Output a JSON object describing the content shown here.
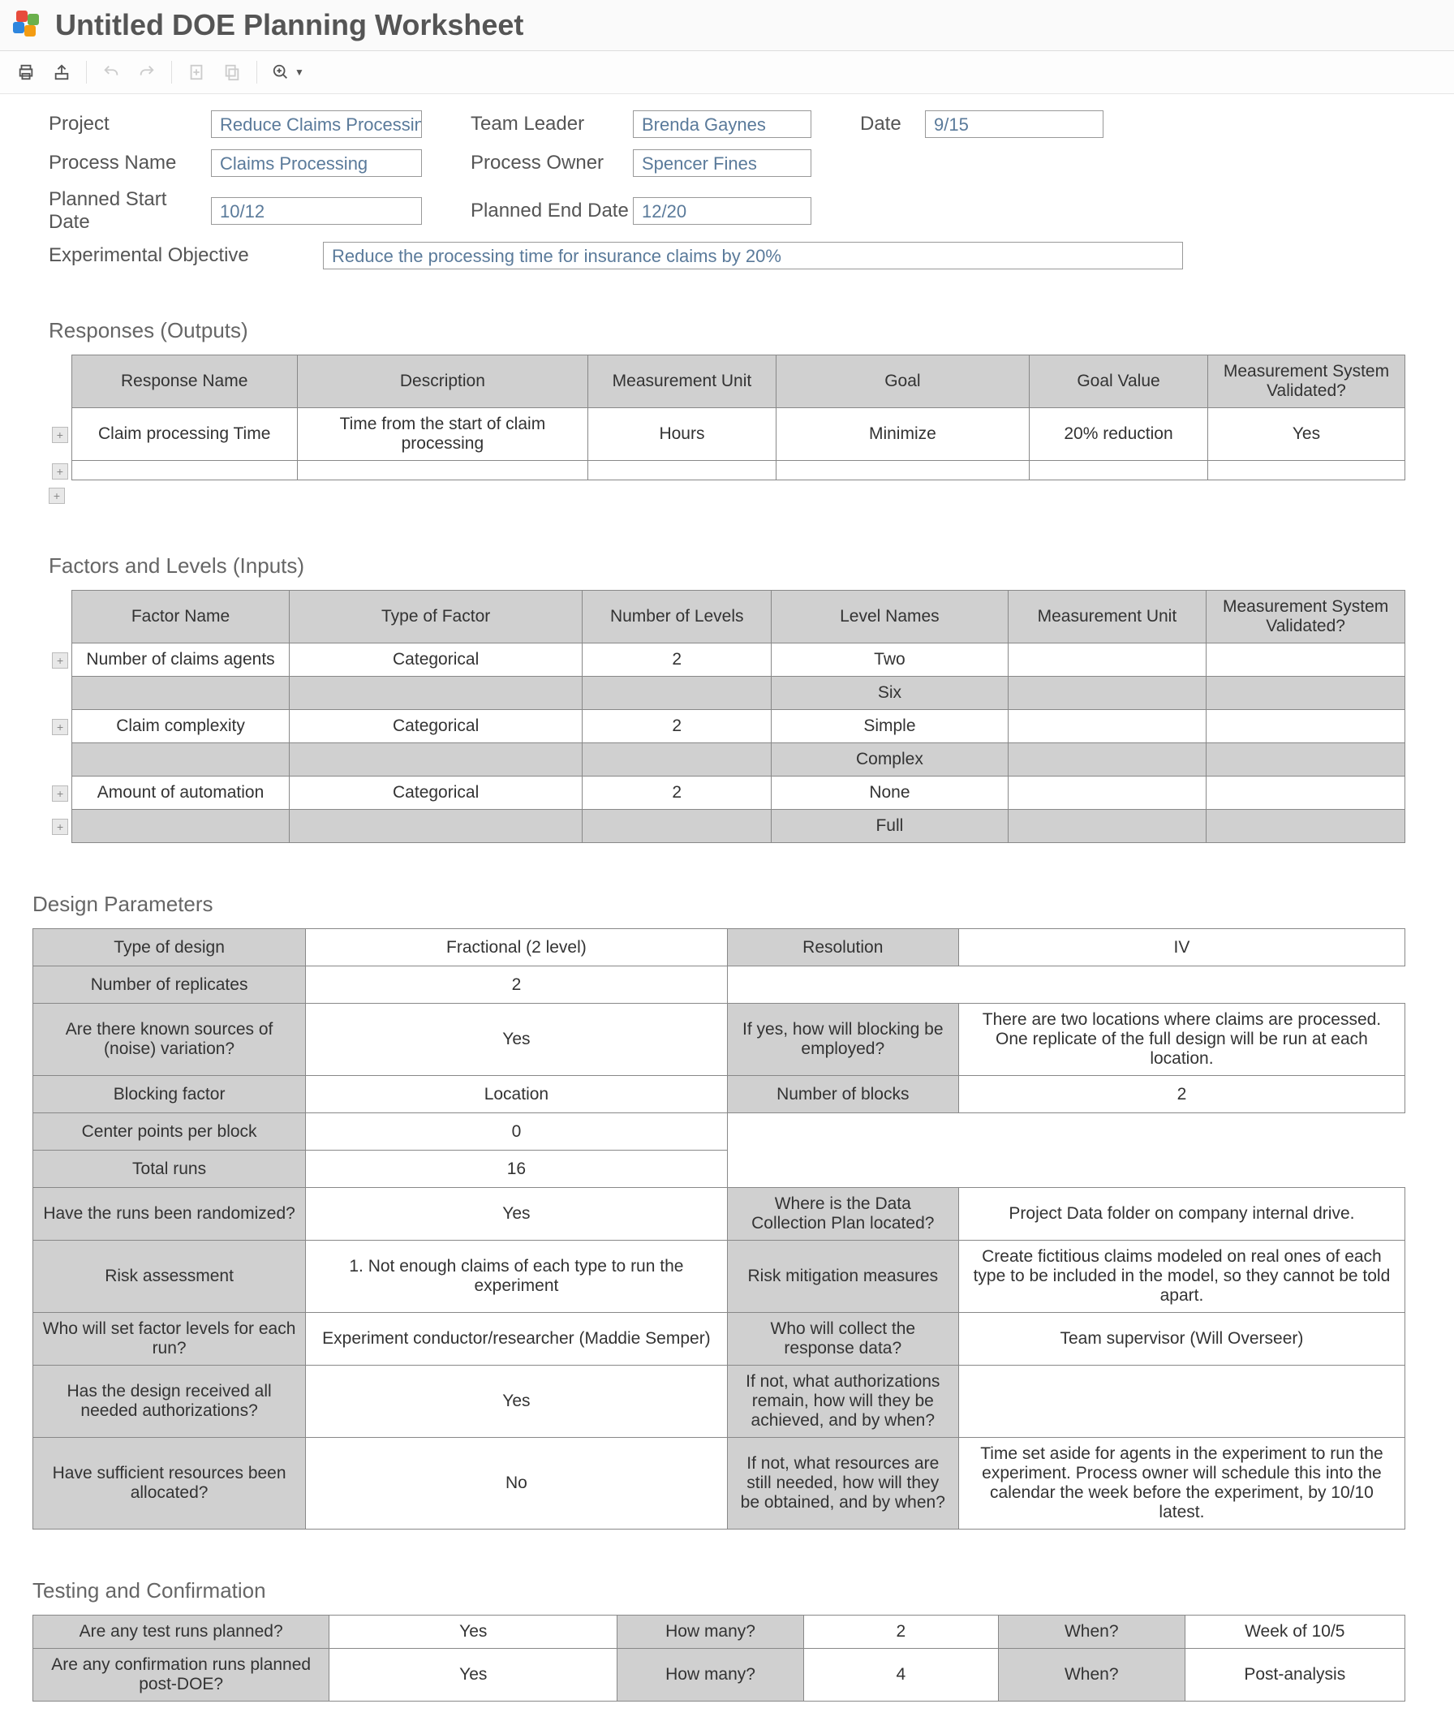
{
  "header": {
    "title": "Untitled DOE Planning Worksheet"
  },
  "toolbar": {
    "print": "print-icon",
    "share": "share-icon",
    "undo": "undo-icon",
    "redo": "redo-icon",
    "add_item": "add-doc-icon",
    "copy": "copy-icon",
    "zoom": "zoom-icon"
  },
  "form": {
    "project_label": "Project",
    "project_value": "Reduce Claims Processin",
    "team_leader_label": "Team Leader",
    "team_leader_value": "Brenda Gaynes",
    "date_label": "Date",
    "date_value": "9/15",
    "process_name_label": "Process Name",
    "process_name_value": "Claims Processing",
    "process_owner_label": "Process Owner",
    "process_owner_value": "Spencer Fines",
    "planned_start_label": "Planned Start Date",
    "planned_start_value": "10/12",
    "planned_end_label": "Planned End Date",
    "planned_end_value": "12/20",
    "objective_label": "Experimental Objective",
    "objective_value": "Reduce the processing time for insurance claims by 20%"
  },
  "responses": {
    "title": "Responses (Outputs)",
    "headers": [
      "Response Name",
      "Description",
      "Measurement Unit",
      "Goal",
      "Goal Value",
      "Measurement System Validated?"
    ],
    "rows": [
      [
        "Claim processing Time",
        "Time from the start of claim processing",
        "Hours",
        "Minimize",
        "20% reduction",
        "Yes"
      ],
      [
        "",
        "",
        "",
        "",
        "",
        ""
      ]
    ]
  },
  "factors": {
    "title": "Factors and Levels (Inputs)",
    "headers": [
      "Factor Name",
      "Type of Factor",
      "Number of Levels",
      "Level Names",
      "Measurement Unit",
      "Measurement System Validated?"
    ],
    "rows": [
      {
        "alt": false,
        "cells": [
          "Number of claims agents",
          "Categorical",
          "2",
          "Two",
          "",
          ""
        ]
      },
      {
        "alt": true,
        "cells": [
          "",
          "",
          "",
          "Six",
          "",
          ""
        ]
      },
      {
        "alt": false,
        "cells": [
          "Claim complexity",
          "Categorical",
          "2",
          "Simple",
          "",
          ""
        ]
      },
      {
        "alt": true,
        "cells": [
          "",
          "",
          "",
          "Complex",
          "",
          ""
        ]
      },
      {
        "alt": false,
        "cells": [
          "Amount of automation",
          "Categorical",
          "2",
          "None",
          "",
          ""
        ]
      },
      {
        "alt": true,
        "cells": [
          "",
          "",
          "",
          "Full",
          "",
          ""
        ]
      }
    ]
  },
  "design": {
    "title": "Design Parameters",
    "rows": [
      {
        "l1": "Type of design",
        "v1": "Fractional (2 level)",
        "l2": "Resolution",
        "v2": "IV"
      },
      {
        "l1": "Number of replicates",
        "v1": "2",
        "l2": "",
        "v2": ""
      },
      {
        "l1": "Are there known sources of (noise) variation?",
        "v1": "Yes",
        "l2": "If yes, how will blocking be employed?",
        "v2": "There are two locations where claims are processed. One replicate of the full design will be run at each location."
      },
      {
        "l1": "Blocking factor",
        "v1": "Location",
        "l2": "Number of blocks",
        "v2": "2"
      },
      {
        "l1": "Center points per block",
        "v1": "0",
        "l2": "",
        "v2": ""
      },
      {
        "l1": "Total runs",
        "v1": "16",
        "l2": "",
        "v2": ""
      },
      {
        "l1": "Have the runs been randomized?",
        "v1": "Yes",
        "l2": "Where is the Data Collection Plan located?",
        "v2": "Project Data folder on company internal drive."
      },
      {
        "l1": "Risk assessment",
        "v1": "1. Not enough claims of each type to run the experiment",
        "l2": "Risk mitigation measures",
        "v2": "Create fictitious claims modeled on real ones of each type to be included in the model, so they cannot be told apart."
      },
      {
        "l1": "Who will set factor levels for each run?",
        "v1": "Experiment conductor/researcher (Maddie Semper)",
        "l2": "Who will collect the response data?",
        "v2": "Team supervisor (Will Overseer)"
      },
      {
        "l1": "Has the design received all needed authorizations?",
        "v1": "Yes",
        "l2": "If not, what authorizations remain, how will they be achieved, and by when?",
        "v2": ""
      },
      {
        "l1": "Have sufficient resources been allocated?",
        "v1": "No",
        "l2": "If not, what resources are still needed, how will they be obtained, and by when?",
        "v2": "Time set aside for agents in the experiment to run the experiment. Process owner will schedule this into the calendar the week before the experiment, by 10/10 latest."
      }
    ]
  },
  "testing": {
    "title": "Testing and Confirmation",
    "rows": [
      {
        "l1": "Are any test runs planned?",
        "v1": "Yes",
        "l2": "How many?",
        "v2": "2",
        "l3": "When?",
        "v3": "Week of 10/5"
      },
      {
        "l1": "Are any confirmation runs planned post-DOE?",
        "v1": "Yes",
        "l2": "How many?",
        "v2": "4",
        "l3": "When?",
        "v3": "Post-analysis"
      }
    ]
  }
}
